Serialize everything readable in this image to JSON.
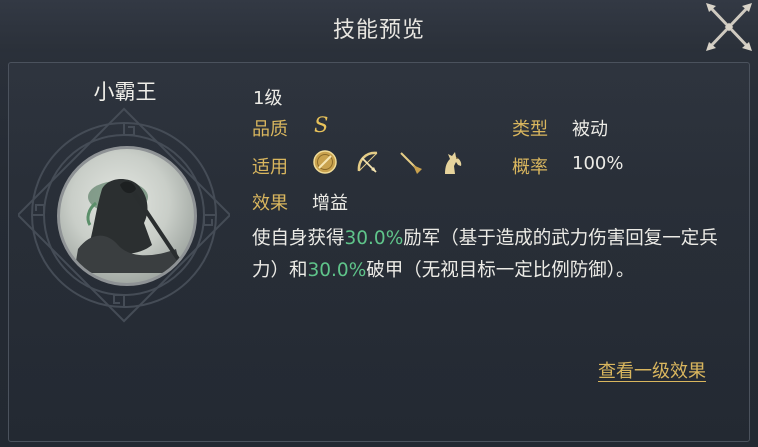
{
  "header": {
    "title": "技能预览"
  },
  "hero": {
    "name": "小霸王"
  },
  "skill": {
    "level": "1级",
    "quality_label": "品质",
    "quality_value": "S",
    "type_label": "类型",
    "type_value": "被动",
    "applies_label": "适用",
    "applies_units": [
      "shield-icon",
      "bow-icon",
      "spear-icon",
      "horse-icon"
    ],
    "chance_label": "概率",
    "chance_value": "100%",
    "effect_label": "效果",
    "effect_value": "增益",
    "description": {
      "part1": "使自身获得",
      "value1": "30.0%",
      "part2": "励军（基于造成的武力伤害回复一定兵力）和",
      "value2": "30.0%",
      "part3": "破甲（无视目标一定比例防御）。"
    }
  },
  "footer": {
    "link_label": "查看一级效果"
  },
  "colors": {
    "gold_label": "#d9b65e",
    "highlight_green": "#5fc48a",
    "text": "#ecebe6"
  }
}
